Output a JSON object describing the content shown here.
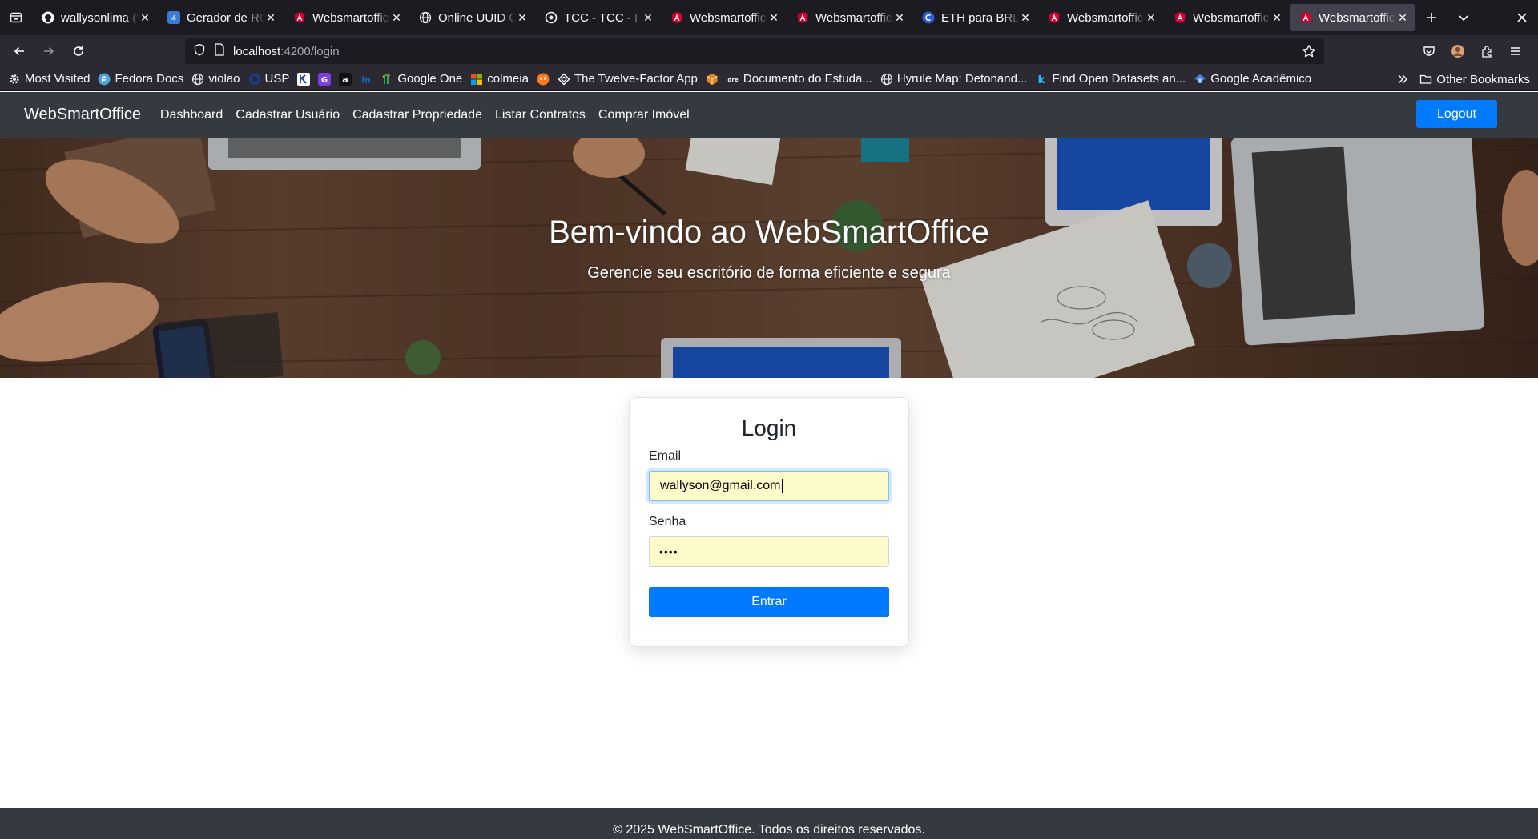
{
  "browser": {
    "tabs": [
      {
        "title": "wallysonlima (W",
        "icon": "github-icon",
        "active": false
      },
      {
        "title": "Gerador de RG",
        "icon": "generator-icon",
        "active": false
      },
      {
        "title": "Websmartoffice",
        "icon": "angular-icon",
        "active": false
      },
      {
        "title": "Online UUID Ge",
        "icon": "globe-icon",
        "active": false
      },
      {
        "title": "TCC - TCC - Fro",
        "icon": "tcc-icon",
        "active": false
      },
      {
        "title": "Websmartoffice",
        "icon": "angular-icon",
        "active": false
      },
      {
        "title": "Websmartoffice",
        "icon": "angular-icon",
        "active": false
      },
      {
        "title": "ETH para BRL: (",
        "icon": "coin-icon",
        "active": false
      },
      {
        "title": "Websmartoffice",
        "icon": "angular-icon",
        "active": false
      },
      {
        "title": "Websmartoffice",
        "icon": "angular-icon",
        "active": false
      },
      {
        "title": "Websmartoffice",
        "icon": "angular-icon",
        "active": true
      }
    ],
    "url_host": "localhost",
    "url_path": ":4200/login",
    "bookmarks": [
      {
        "label": "Most Visited",
        "icon": "gear-icon"
      },
      {
        "label": "Fedora Docs",
        "icon": "fedora-icon"
      },
      {
        "label": "violao",
        "icon": "globe-icon"
      },
      {
        "label": "USP",
        "icon": "usp-icon"
      },
      {
        "label": "",
        "icon": "k-icon"
      },
      {
        "label": "",
        "icon": "g-icon"
      },
      {
        "label": "",
        "icon": "a-icon"
      },
      {
        "label": "",
        "icon": "linkedin-icon"
      },
      {
        "label": "Google One",
        "icon": "google-one-icon"
      },
      {
        "label": "colmeia",
        "icon": "microsoft-icon"
      },
      {
        "label": "",
        "icon": "mask-icon"
      },
      {
        "label": "The Twelve-Factor App",
        "icon": "diamond-icon"
      },
      {
        "label": "",
        "icon": "box-icon"
      },
      {
        "label": "Documento do Estuda...",
        "icon": "document-icon"
      },
      {
        "label": "Hyrule Map: Detonand...",
        "icon": "globe-icon"
      },
      {
        "label": "Find Open Datasets an...",
        "icon": "kaggle-icon"
      },
      {
        "label": "Google Acadêmico",
        "icon": "scholar-icon"
      }
    ],
    "other_bookmarks": "Other Bookmarks"
  },
  "app": {
    "brand": "WebSmartOffice",
    "nav_links": [
      "Dashboard",
      "Cadastrar Usuário",
      "Cadastrar Propriedade",
      "Listar Contratos",
      "Comprar Imóvel"
    ],
    "logout_label": "Logout",
    "hero_title": "Bem-vindo ao WebSmartOffice",
    "hero_subtitle": "Gerencie seu escritório de forma eficiente e segura",
    "login": {
      "title": "Login",
      "email_label": "Email",
      "email_value": "wallyson@gmail.com",
      "password_label": "Senha",
      "password_value": "••••",
      "submit_label": "Entrar"
    },
    "footer": "© 2025 WebSmartOffice. Todos os direitos reservados."
  },
  "colors": {
    "primary": "#007bff",
    "navbar": "#343a40",
    "autofill": "#fdfbc9"
  }
}
